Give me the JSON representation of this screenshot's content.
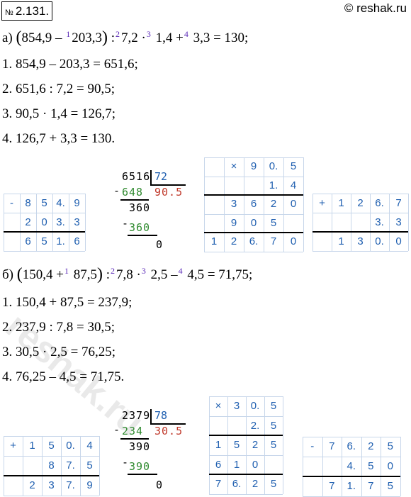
{
  "header": {
    "number_prefix": "№",
    "number": "2.131.",
    "copyright": "© reshak.ru"
  },
  "part_a": {
    "expr": [
      "а)",
      "(",
      "854,9 –",
      "1",
      "203,3",
      ")",
      ":",
      "2",
      "7,2 ·",
      "3",
      "1,4 +",
      "4",
      "3,3 = 130;"
    ],
    "steps": [
      "1.  854,9 – 203,3 = 651,6;",
      "2.  651,6  :  7,2 = 90,5;",
      "3.  90,5 · 1,4 = 126,7;",
      "4.  126,7 + 3,3 = 130."
    ]
  },
  "part_b": {
    "expr": [
      "б)",
      "(",
      "150,4 +",
      "1",
      "87,5",
      ")",
      ":",
      "2",
      "7,8 ·",
      "3",
      "2,5 –",
      "4",
      "4,5 = 71,75;"
    ],
    "steps": [
      "1.  150,4 + 87,5 = 237,9;",
      "2.  237,9  :  7,8 = 30,5;",
      "3.  30,5 · 2,5 = 76,25;",
      "4.  76,25 – 4,5 = 71,75."
    ]
  },
  "grids": {
    "a1": {
      "rows": [
        [
          "-",
          "8",
          "5",
          "4.",
          "9"
        ],
        [
          "",
          "2",
          "0",
          "3.",
          "3"
        ],
        [
          "",
          "6",
          "5",
          "1.",
          "6"
        ]
      ]
    },
    "a3": {
      "rows": [
        [
          "",
          "×",
          "9",
          "0.",
          "5"
        ],
        [
          "",
          "",
          "",
          "1.",
          "4"
        ],
        [
          "",
          "3",
          "6",
          "2",
          "0"
        ],
        [
          "",
          "9",
          "0",
          "5",
          ""
        ],
        [
          "1",
          "2",
          "6.",
          "7",
          "0"
        ]
      ]
    },
    "a4": {
      "rows": [
        [
          "+",
          "1",
          "2",
          "6.",
          "7"
        ],
        [
          "",
          "",
          "",
          "3.",
          "3"
        ],
        [
          "",
          "1",
          "3",
          "0.",
          "0"
        ]
      ]
    },
    "b1": {
      "rows": [
        [
          "+",
          "1",
          "5",
          "0.",
          "4"
        ],
        [
          "",
          "",
          "8",
          "7.",
          "5"
        ],
        [
          "",
          "2",
          "3",
          "7.",
          "9"
        ]
      ]
    },
    "b3": {
      "rows": [
        [
          "×",
          "3",
          "0.",
          "5"
        ],
        [
          "",
          "",
          "2.",
          "5"
        ],
        [
          "1",
          "5",
          "2",
          "5"
        ],
        [
          "6",
          "1",
          "0",
          ""
        ],
        [
          "7",
          "6.",
          "2",
          "5"
        ]
      ]
    },
    "b4": {
      "rows": [
        [
          "-",
          "7",
          "6.",
          "2",
          "5"
        ],
        [
          "",
          "",
          "4.",
          "5",
          "0"
        ],
        [
          "",
          "7",
          "1.",
          "7",
          "5"
        ]
      ]
    }
  },
  "div_a": {
    "minus1": "-",
    "dividend": "6516",
    "divisor": "72",
    "sub1": "648",
    "quotient": "90.5",
    "rem": "360",
    "minus2": "-",
    "sub2": "360",
    "zero": "0"
  },
  "div_b": {
    "minus1": "-",
    "dividend": "2379",
    "divisor": "78",
    "sub1": "234",
    "quotient": "30.5",
    "rem": "390",
    "minus2": "-",
    "sub2": "390",
    "zero": "0"
  },
  "watermark": "reshak.ru"
}
